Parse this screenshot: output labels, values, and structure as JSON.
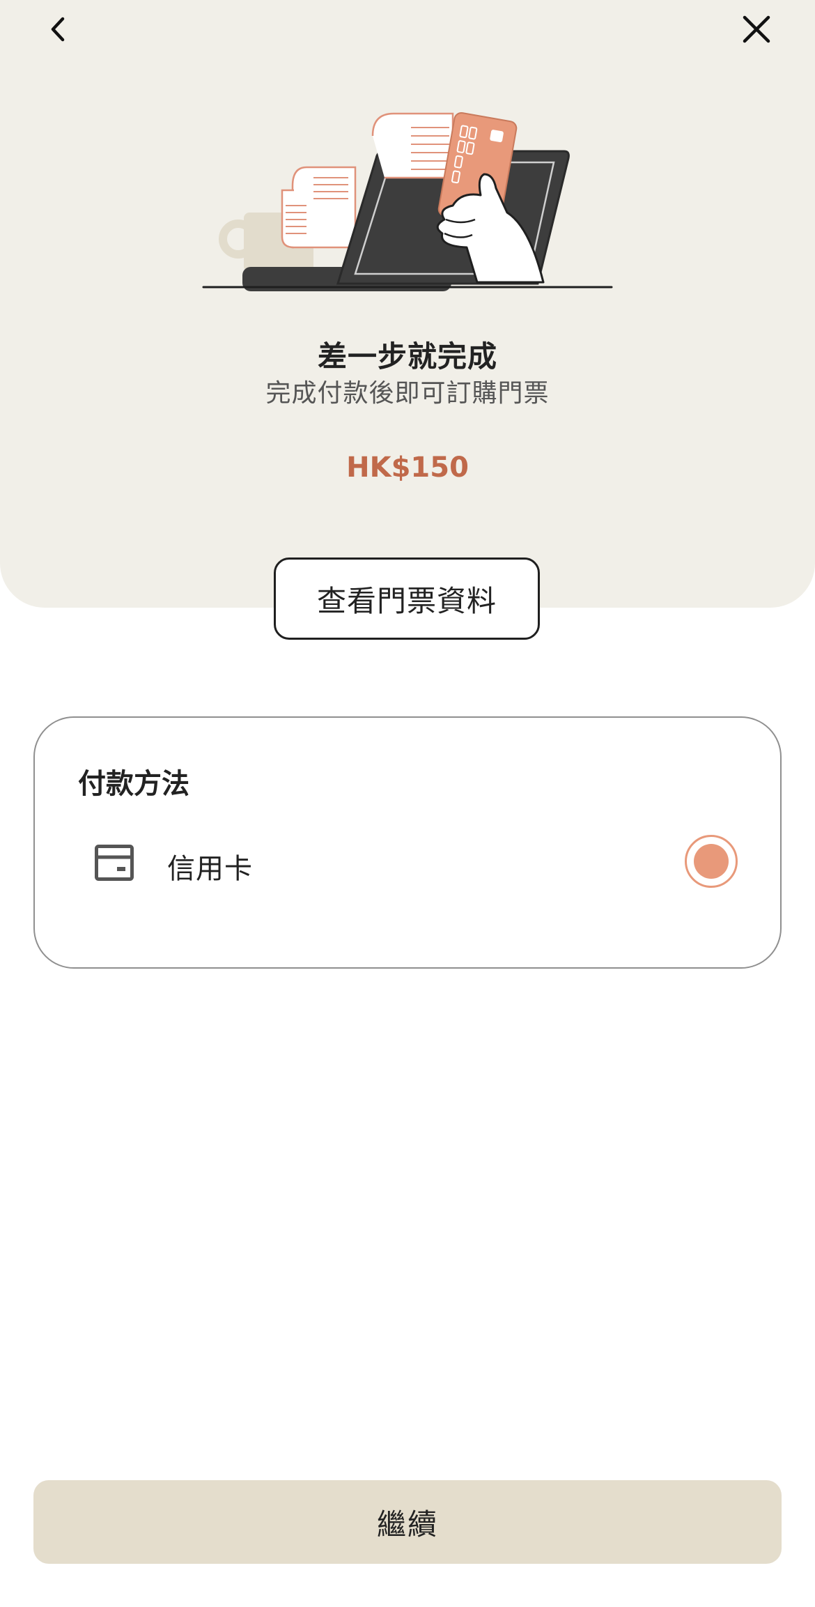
{
  "header": {
    "back_icon": "chevron-left-icon",
    "close_icon": "close-icon"
  },
  "hero": {
    "illustration": "payment-illustration",
    "title": "差一步就完成",
    "subtitle": "完成付款後即可訂購門票",
    "amount": "HK$150"
  },
  "ticket_details_button": {
    "label": "查看門票資料"
  },
  "payment": {
    "title": "付款方法",
    "options": [
      {
        "icon": "credit-card-icon",
        "label": "信用卡",
        "selected": true
      }
    ]
  },
  "footer": {
    "continue_label": "繼續"
  },
  "colors": {
    "hero_bg": "#f1efe8",
    "accent": "#e8997a",
    "amount": "#c0694a",
    "button_bg": "#e4ddcc"
  }
}
